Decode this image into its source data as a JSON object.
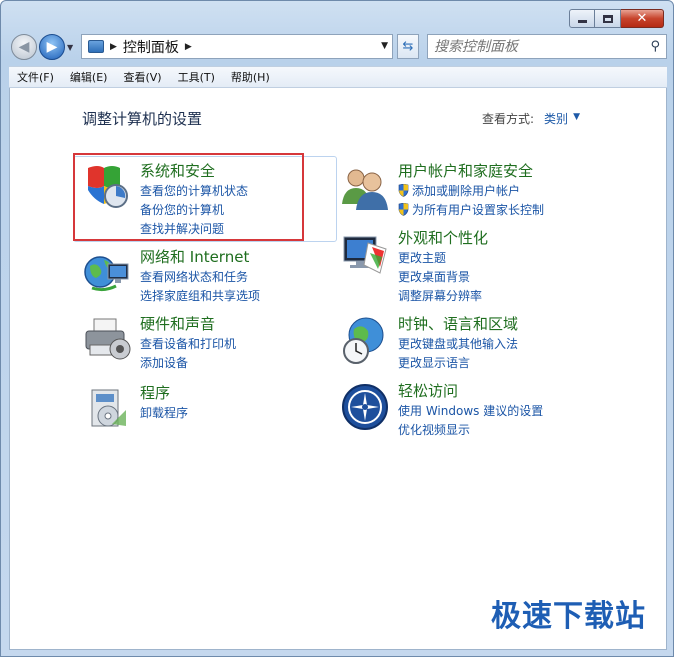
{
  "address": {
    "path": "控制面板"
  },
  "search": {
    "placeholder": "搜索控制面板"
  },
  "menu": [
    "文件(F)",
    "编辑(E)",
    "查看(V)",
    "工具(T)",
    "帮助(H)"
  ],
  "page": {
    "heading": "调整计算机的设置",
    "view_by_label": "查看方式:",
    "view_by_value": "类别"
  },
  "categories": {
    "system": {
      "title": "系统和安全",
      "links": [
        "查看您的计算机状态",
        "备份您的计算机",
        "查找并解决问题"
      ]
    },
    "network": {
      "title": "网络和 Internet",
      "links": [
        "查看网络状态和任务",
        "选择家庭组和共享选项"
      ]
    },
    "hardware": {
      "title": "硬件和声音",
      "links": [
        "查看设备和打印机",
        "添加设备"
      ]
    },
    "programs": {
      "title": "程序",
      "links": [
        "卸载程序"
      ]
    },
    "users": {
      "title": "用户帐户和家庭安全",
      "links": [
        "添加或删除用户帐户",
        "为所有用户设置家长控制"
      ]
    },
    "appearance": {
      "title": "外观和个性化",
      "links": [
        "更改主题",
        "更改桌面背景",
        "调整屏幕分辨率"
      ]
    },
    "clock": {
      "title": "时钟、语言和区域",
      "links": [
        "更改键盘或其他输入法",
        "更改显示语言"
      ]
    },
    "ease": {
      "title": "轻松访问",
      "links": [
        "使用 Windows 建议的设置",
        "优化视频显示"
      ]
    }
  },
  "watermark": "极速下载站",
  "colors": {
    "highlight_border": "#d6373a",
    "link": "#1b55a6",
    "title": "#1f6e1f"
  }
}
